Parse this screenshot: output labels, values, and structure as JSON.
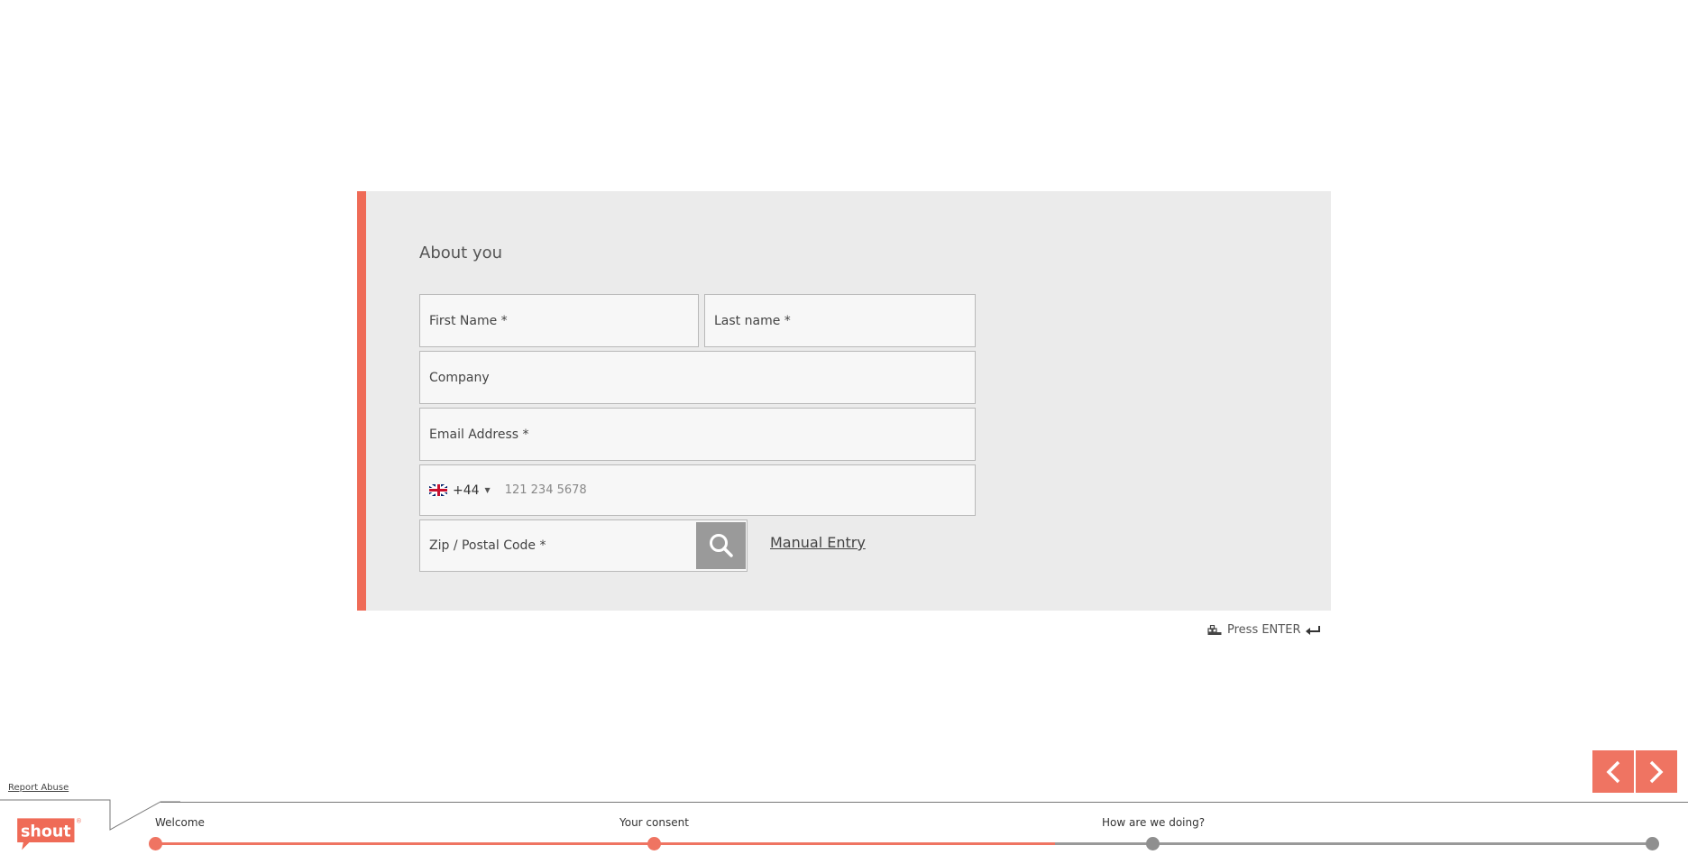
{
  "form": {
    "section_title": "About you",
    "first_name": {
      "placeholder": "First Name *"
    },
    "last_name": {
      "placeholder": "Last name *"
    },
    "company": {
      "placeholder": "Company"
    },
    "email": {
      "placeholder": "Email Address *"
    },
    "phone": {
      "country_code": "+44",
      "country_flag": "uk-flag-icon",
      "placeholder": "121 234 5678"
    },
    "postal_code": {
      "placeholder": "Zip / Postal Code *"
    },
    "manual_entry_label": "Manual Entry"
  },
  "hint": {
    "press_enter": "Press ENTER"
  },
  "navigation": {
    "prev_icon": "chevron-left-icon",
    "next_icon": "chevron-right-icon"
  },
  "footer": {
    "report_abuse": "Report Abuse",
    "logo_text": "shout",
    "logo_mark": "®",
    "progress": {
      "steps": [
        {
          "label": "Welcome",
          "status": "complete"
        },
        {
          "label": "Your consent",
          "status": "complete"
        },
        {
          "label": "How are we doing?",
          "status": "incomplete"
        },
        {
          "label": "",
          "status": "incomplete"
        }
      ]
    }
  },
  "colors": {
    "accent": "#ef6b57",
    "card_bg": "#ebebeb",
    "inactive": "#999999"
  }
}
